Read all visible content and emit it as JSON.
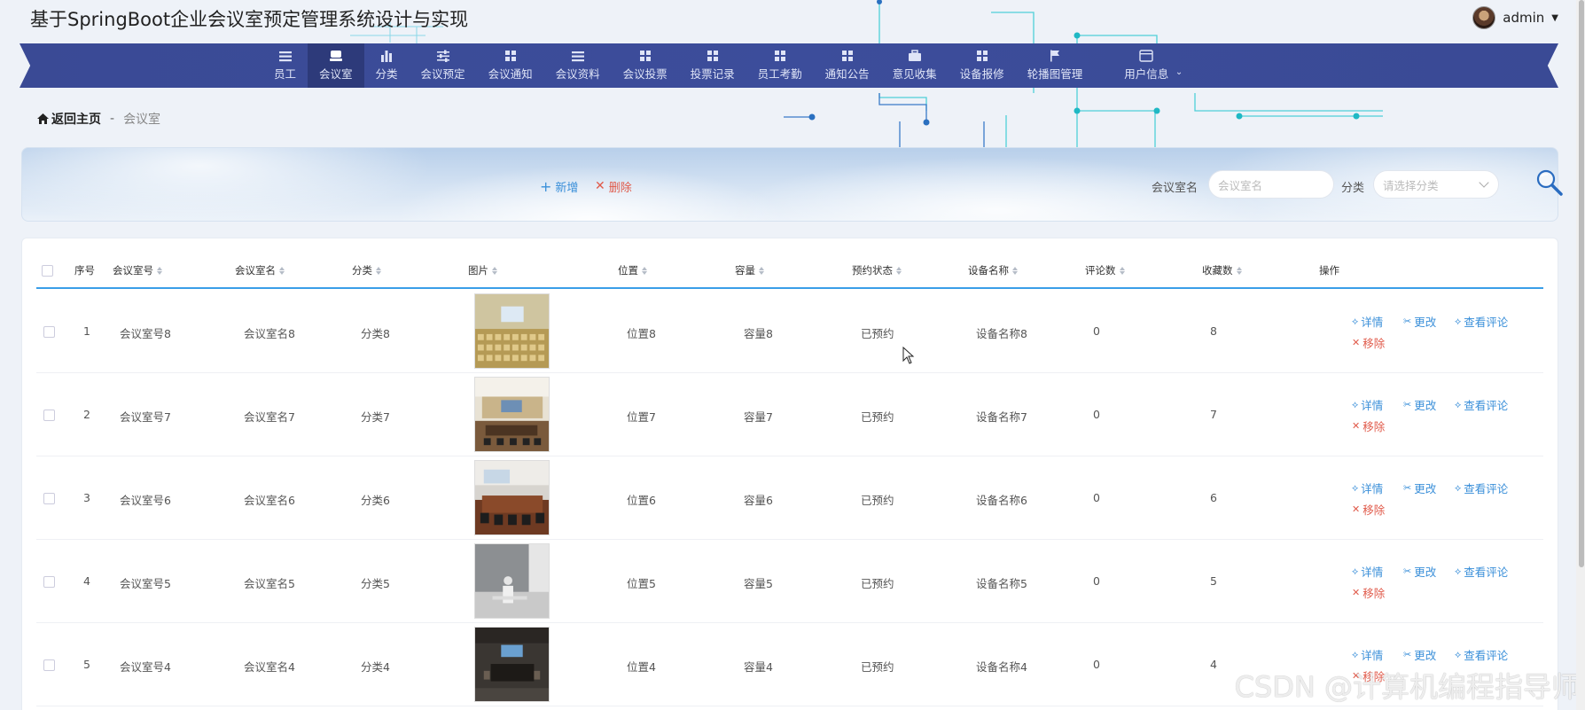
{
  "app": {
    "title": "基于SpringBoot企业会议室预定管理系统设计与实现"
  },
  "user": {
    "name": "admin"
  },
  "nav": {
    "items": [
      {
        "label": "员工",
        "icon": "list-icon"
      },
      {
        "label": "会议室",
        "icon": "room-icon",
        "active": true
      },
      {
        "label": "分类",
        "icon": "bar-chart-icon"
      },
      {
        "label": "会议预定",
        "icon": "sliders-icon"
      },
      {
        "label": "会议通知",
        "icon": "grid-icon"
      },
      {
        "label": "会议资料",
        "icon": "list-icon"
      },
      {
        "label": "会议投票",
        "icon": "grid-icon"
      },
      {
        "label": "投票记录",
        "icon": "grid-icon"
      },
      {
        "label": "员工考勤",
        "icon": "grid-icon"
      },
      {
        "label": "通知公告",
        "icon": "grid-icon"
      },
      {
        "label": "意见收集",
        "icon": "briefcase-icon"
      },
      {
        "label": "设备报修",
        "icon": "grid-icon"
      },
      {
        "label": "轮播图管理",
        "icon": "flag-icon"
      },
      {
        "label": "用户信息",
        "icon": "card-icon"
      }
    ]
  },
  "breadcrumb": {
    "home": "返回主页",
    "separator": "-",
    "current": "会议室"
  },
  "toolbar": {
    "add_label": "新增",
    "delete_label": "删除",
    "name_label": "会议室名",
    "name_placeholder": "会议室名",
    "category_label": "分类",
    "category_placeholder": "请选择分类"
  },
  "table": {
    "headers": {
      "index": "序号",
      "room_no": "会议室号",
      "room_name": "会议室名",
      "category": "分类",
      "image": "图片",
      "location": "位置",
      "capacity": "容量",
      "status": "预约状态",
      "device": "设备名称",
      "comments": "评论数",
      "favorites": "收藏数",
      "ops": "操作"
    },
    "actions": {
      "detail": "详情",
      "edit": "更改",
      "comments": "查看评论",
      "remove": "移除"
    },
    "rows": [
      {
        "index": "1",
        "room_no": "会议室号8",
        "room_name": "会议室名8",
        "category": "分类8",
        "location": "位置8",
        "capacity": "容量8",
        "status": "已预约",
        "device": "设备名称8",
        "comments": "0",
        "favorites": "8"
      },
      {
        "index": "2",
        "room_no": "会议室号7",
        "room_name": "会议室名7",
        "category": "分类7",
        "location": "位置7",
        "capacity": "容量7",
        "status": "已预约",
        "device": "设备名称7",
        "comments": "0",
        "favorites": "7"
      },
      {
        "index": "3",
        "room_no": "会议室号6",
        "room_name": "会议室名6",
        "category": "分类6",
        "location": "位置6",
        "capacity": "容量6",
        "status": "已预约",
        "device": "设备名称6",
        "comments": "0",
        "favorites": "6"
      },
      {
        "index": "4",
        "room_no": "会议室号5",
        "room_name": "会议室名5",
        "category": "分类5",
        "location": "位置5",
        "capacity": "容量5",
        "status": "已预约",
        "device": "设备名称5",
        "comments": "0",
        "favorites": "5"
      },
      {
        "index": "5",
        "room_no": "会议室号4",
        "room_name": "会议室名4",
        "category": "分类4",
        "location": "位置4",
        "capacity": "容量4",
        "status": "已预约",
        "device": "设备名称4",
        "comments": "0",
        "favorites": "4"
      }
    ]
  },
  "watermark": "CSDN @计算机编程指导师",
  "colors": {
    "nav_bg": "#3b4c99",
    "nav_active": "#2d3a7a",
    "accent_blue": "#3a8fd9",
    "danger_red": "#e05a4a",
    "header_line": "#3a9ee8"
  }
}
